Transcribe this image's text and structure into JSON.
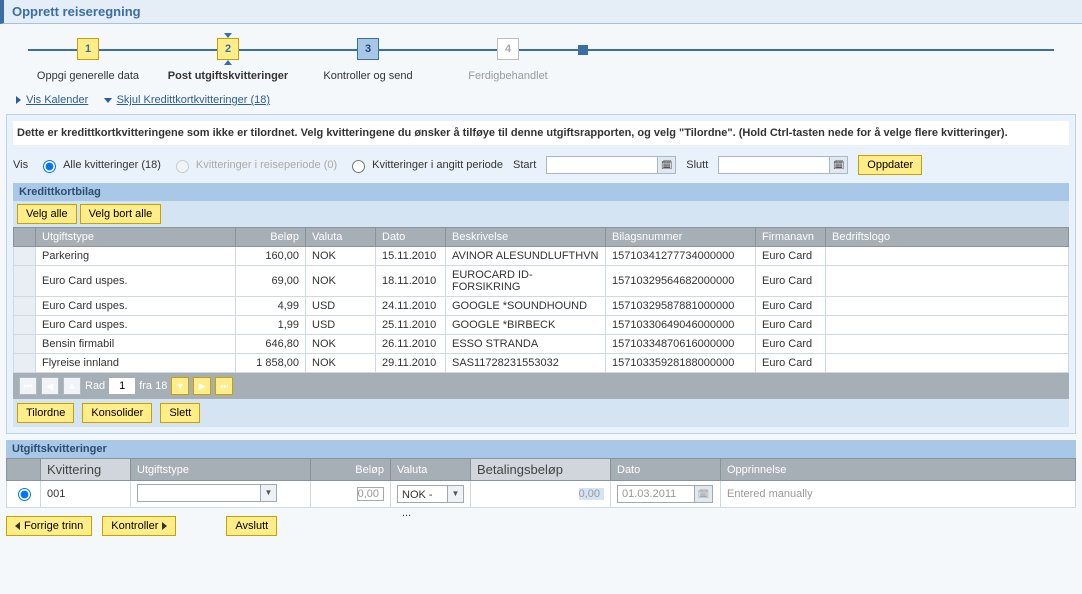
{
  "page_title": "Opprett reiseregning",
  "wizard": {
    "steps": [
      {
        "num": "1",
        "label": "Oppgi generelle data",
        "state": "done"
      },
      {
        "num": "2",
        "label": "Post utgiftskvitteringer",
        "state": "current"
      },
      {
        "num": "3",
        "label": "Kontroller og send",
        "state": "future-blue"
      },
      {
        "num": "4",
        "label": "Ferdigbehandlet",
        "state": "disabled"
      }
    ]
  },
  "links": {
    "show_calendar": "Vis Kalender",
    "hide_cc": "Skjul Kredittkortkvitteringer (18)"
  },
  "cc_section": {
    "instruction": "Dette er kredittkortkvitteringene som ikke er tilordnet. Velg kvitteringene du ønsker å tilføye til denne utgiftsrapporten, og velg \"Tilordne\". (Hold Ctrl-tasten nede for å velge flere kvitteringer).",
    "vis_label": "Vis",
    "radio_all": "Alle kvitteringer  (18)",
    "radio_period": "Kvitteringer i reiseperiode (0)",
    "radio_custom": "Kvitteringer i angitt periode",
    "start_label": "Start",
    "end_label": "Slutt",
    "update_btn": "Oppdater",
    "table_title": "Kredittkortbilag",
    "select_all": "Velg alle",
    "deselect_all": "Velg bort alle",
    "headers": {
      "expense_type": "Utgiftstype",
      "amount": "Beløp",
      "currency": "Valuta",
      "date": "Dato",
      "description": "Beskrivelse",
      "doc_no": "Bilagsnummer",
      "company": "Firmanavn",
      "logo": "Bedriftslogo"
    },
    "rows": [
      {
        "type": "Parkering",
        "amount": "160,00",
        "curr": "NOK",
        "date": "15.11.2010",
        "desc": "AVINOR ALESUNDLUFTHVN",
        "doc": "15710341277734000000",
        "company": "Euro Card"
      },
      {
        "type": "Euro Card uspes.",
        "amount": "69,00",
        "curr": "NOK",
        "date": "18.11.2010",
        "desc": "EUROCARD ID-FORSIKRING",
        "doc": "15710329564682000000",
        "company": "Euro Card"
      },
      {
        "type": "Euro Card uspes.",
        "amount": "4,99",
        "curr": "USD",
        "date": "24.11.2010",
        "desc": "GOOGLE *SOUNDHOUND",
        "doc": "15710329587881000000",
        "company": "Euro Card"
      },
      {
        "type": "Euro Card uspes.",
        "amount": "1,99",
        "curr": "USD",
        "date": "25.11.2010",
        "desc": "GOOGLE *BIRBECK",
        "doc": "15710330649046000000",
        "company": "Euro Card"
      },
      {
        "type": "Bensin  firmabil",
        "amount": "646,80",
        "curr": "NOK",
        "date": "26.11.2010",
        "desc": "ESSO STRANDA",
        "doc": "15710334870616000000",
        "company": "Euro Card"
      },
      {
        "type": "Flyreise innland",
        "amount": "1 858,00",
        "curr": "NOK",
        "date": "29.11.2010",
        "desc": "SAS11728231553032",
        "doc": "15710335928188000000",
        "company": "Euro Card"
      }
    ],
    "pager": {
      "row_label": "Rad",
      "row_value": "1",
      "of_label": "fra 18"
    },
    "assign_btn": "Tilordne",
    "consolidate_btn": "Konsolider",
    "delete_btn": "Slett"
  },
  "exp_section": {
    "title": "Utgiftskvitteringer",
    "headers": {
      "receipt": "Kvittering",
      "expense_type": "Utgiftstype",
      "amount": "Beløp",
      "currency": "Valuta",
      "payment_amount": "Betalingsbeløp",
      "date": "Dato",
      "origin": "Opprinnelse"
    },
    "row": {
      "id": "001",
      "amount": "0,00",
      "currency": "NOK - ...",
      "pay_amount": "0,00",
      "date": "01.03.2011",
      "origin": "Entered manually"
    }
  },
  "nav": {
    "prev": "Forrige trinn",
    "check": "Kontroller",
    "exit": "Avslutt"
  }
}
